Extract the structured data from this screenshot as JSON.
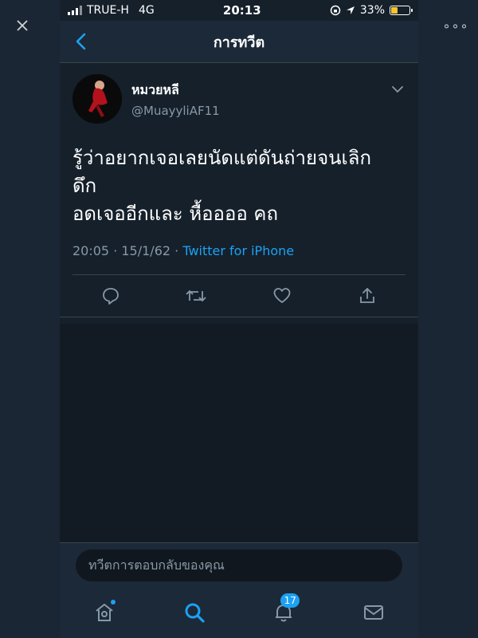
{
  "status_bar": {
    "carrier": "TRUE-H",
    "network": "4G",
    "time": "20:13",
    "battery": "33%",
    "battery_level": 0.33
  },
  "nav": {
    "title": "การทวีต",
    "back_icon": "chevron-left-icon"
  },
  "tweet": {
    "display_name": "หมวยหลี",
    "handle": "@MuayyliAF11",
    "text_lines": [
      "รู้ว่าอยากเจอเลยนัดแต่ดันถ่ายจนเลิก",
      "ดึก",
      "อดเจออีกและ หื้ออออ คถ"
    ],
    "timestamp": "20:05 · 15/1/62 · ",
    "source": "Twitter for iPhone"
  },
  "actions": {
    "reply_icon": "comment-icon",
    "retweet_icon": "retweet-icon",
    "like_icon": "heart-icon",
    "share_icon": "share-icon"
  },
  "reply": {
    "placeholder": "ทวีตการตอบกลับของคุณ"
  },
  "tabs": {
    "home_icon": "home-icon",
    "search_icon": "search-icon",
    "notifications_icon": "bell-icon",
    "notifications_count": "17",
    "messages_icon": "mail-icon"
  },
  "colors": {
    "accent": "#1da1f2",
    "background": "#15202b",
    "text_secondary": "#8899a6"
  }
}
